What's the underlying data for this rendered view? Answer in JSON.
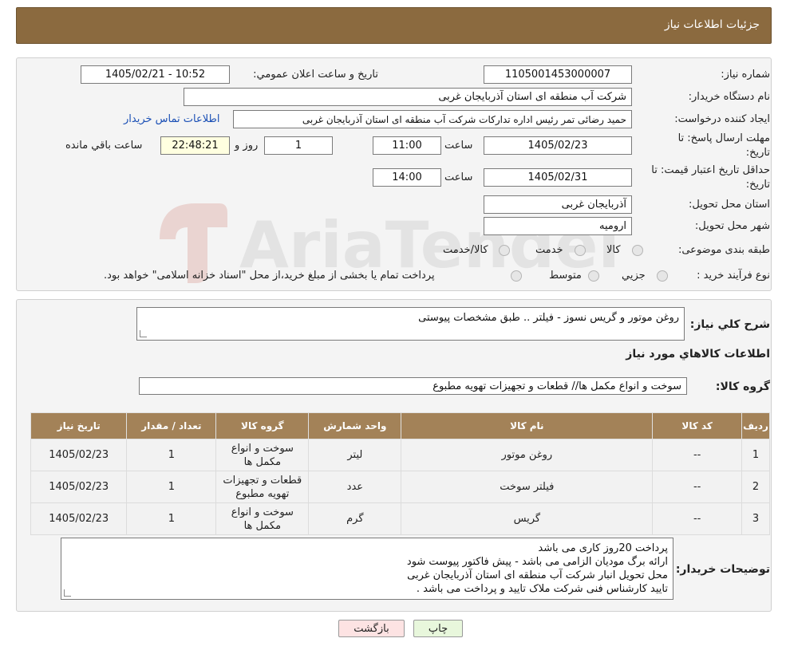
{
  "header": {
    "title": "جزئیات اطلاعات نیاز"
  },
  "form": {
    "need_number_label": "شماره نیاز:",
    "need_number": "1105001453000007",
    "announce_label": "تاریخ و ساعت اعلان عمومي:",
    "announce_value": "1405/02/21 - 10:52",
    "buyer_org_label": "نام دستگاه خريدار:",
    "buyer_org": "شرکت آب منطقه ای استان آذربایجان غربی",
    "requester_label": "ایجاد کننده درخواست:",
    "requester": "حمید رضائی تمر رئیس اداره تدارکات شرکت آب منطقه ای استان آذربایجان غربی",
    "contact_link": "اطلاعات تماس خريدار",
    "deadline_label_1": "مهلت ارسال پاسخ: تا",
    "deadline_label_2": "تاريخ:",
    "deadline_date": "1405/02/23",
    "time_label": "ساعت",
    "deadline_time": "11:00",
    "days_value": "1",
    "days_label": "روز و",
    "remaining_time": "22:48:21",
    "remaining_label": "ساعت باقي مانده",
    "validity_label_1": "حداقل تاريخ اعتبار قيمت: تا",
    "validity_label_2": "تاريخ:",
    "validity_date": "1405/02/31",
    "validity_time": "14:00",
    "province_label": "استان محل تحویل:",
    "province": "آذربایجان غربی",
    "city_label": "شهر محل تحویل:",
    "city": "ارومیه",
    "category_label": "طبقه بندی موضوعی:",
    "category_options": [
      "کالا",
      "خدمت",
      "کالا/خدمت"
    ],
    "process_label": "نوع فرآيند خريد :",
    "process_options": [
      "جزيي",
      "متوسط"
    ],
    "process_note": "پرداخت تمام یا بخشی از مبلغ خرید،از محل \"اسناد خزانه اسلامی\" خواهد بود."
  },
  "description": {
    "label": "شرح کلي نياز:",
    "value": "روغن موتور و گریس نسوز - فیلتر .. طبق مشخصات پیوستی"
  },
  "goods": {
    "section_title": "اطلاعات کالاهاي مورد نياز",
    "group_label": "گروه کالا:",
    "group_value": "سوخت و انواع مکمل ها//  قطعات و تجهیزات تهویه مطبوع",
    "columns": [
      "رديف",
      "کد کالا",
      "نام کالا",
      "واحد شمارش",
      "گروه کالا",
      "تعداد / مقدار",
      "تاريخ نياز"
    ],
    "rows": [
      {
        "row": "1",
        "code": "--",
        "name": "روغن موتور",
        "unit": "لیتر",
        "group": "سوخت و انواع مکمل ها",
        "qty": "1",
        "date": "1405/02/23"
      },
      {
        "row": "2",
        "code": "--",
        "name": "فیلتر سوخت",
        "unit": "عدد",
        "group": "قطعات و تجهیزات تهویه مطبوع",
        "qty": "1",
        "date": "1405/02/23"
      },
      {
        "row": "3",
        "code": "--",
        "name": "گریس",
        "unit": "گرم",
        "group": "سوخت و انواع مکمل ها",
        "qty": "1",
        "date": "1405/02/23"
      }
    ]
  },
  "buyer_notes": {
    "label": "توضیحات خریدار:",
    "lines": [
      "پرداخت 20روز کاری می باشد",
      "ارائه برگ مودیان الزامی  می باشد - پیش فاکتور پیوست شود",
      "محل تحویل انبار شرکت آب منطقه ای استان آذربایجان غربی",
      "تایید کارشناس فنی شرکت ملاک تایید و پرداخت می باشد ."
    ]
  },
  "buttons": {
    "print": "چاپ",
    "back": "بازگشت"
  },
  "watermark": {
    "text": "AriaTender.neT"
  },
  "colors": {
    "header_bg": "#8b6a3f",
    "table_header_bg": "#a38258",
    "back_btn_bg": "#fde3e3",
    "print_btn_bg": "#e8f7dc"
  }
}
